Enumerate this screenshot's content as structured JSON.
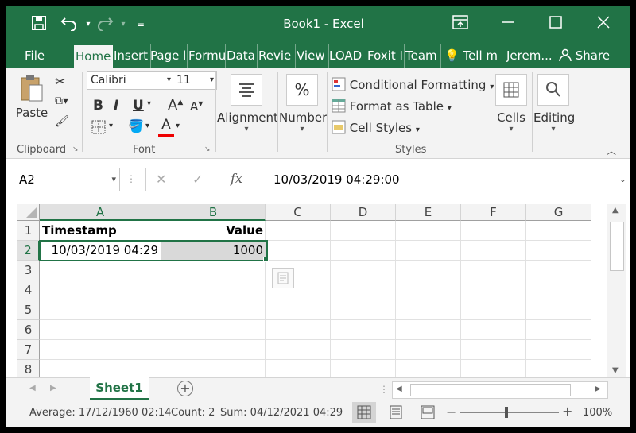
{
  "window": {
    "title": "Book1  -  Excel",
    "buttons": {
      "ribbon_display": "ribbon-display-icon",
      "minimize": "minimize-icon",
      "maximize": "maximize-icon",
      "close": "close-icon"
    }
  },
  "qat": {
    "save": "save-icon",
    "undo": "undo-icon",
    "redo": "redo-icon",
    "customize": "customize-qat-icon"
  },
  "tabs": [
    {
      "label": "File"
    },
    {
      "label": "Home"
    },
    {
      "label": "Insert"
    },
    {
      "label": "Page l"
    },
    {
      "label": "Formu"
    },
    {
      "label": "Data"
    },
    {
      "label": "Revie"
    },
    {
      "label": "View"
    },
    {
      "label": "LOAD"
    },
    {
      "label": "Foxit I"
    },
    {
      "label": "Team"
    },
    {
      "label": "Tell m"
    },
    {
      "label": "Jerem..."
    },
    {
      "label": "Share"
    }
  ],
  "ribbon": {
    "clipboard": {
      "paste_label": "Paste",
      "group_label": "Clipboard"
    },
    "font": {
      "font_name": "Calibri",
      "font_size": "11",
      "bold": "B",
      "italic": "I",
      "underline": "U",
      "group_label": "Font"
    },
    "alignment_label": "Alignment",
    "number": {
      "symbol": "%",
      "label": "Number"
    },
    "styles": {
      "conditional": "Conditional Formatting",
      "format_table": "Format as Table",
      "cell_styles": "Cell Styles",
      "group_label": "Styles"
    },
    "cells_label": "Cells",
    "editing_label": "Editing"
  },
  "formula_bar": {
    "name_box": "A2",
    "fx": "fx",
    "content": "10/03/2019  04:29:00"
  },
  "grid": {
    "columns": [
      "A",
      "B",
      "C",
      "D",
      "E",
      "F",
      "G"
    ],
    "rows": [
      "1",
      "2",
      "3",
      "4",
      "5",
      "6",
      "7",
      "8"
    ],
    "cells": {
      "A1": "Timestamp",
      "B1": "Value",
      "A2": "10/03/2019 04:29",
      "B2": "1000"
    }
  },
  "sheets": [
    {
      "label": "Sheet1"
    }
  ],
  "status": {
    "average": "Average: 17/12/1960 02:14",
    "count": "Count: 2",
    "sum": "Sum: 04/12/2021 04:29",
    "zoom": "100%"
  },
  "colors": {
    "accent": "#217346",
    "selection": "#d9d9d9"
  }
}
